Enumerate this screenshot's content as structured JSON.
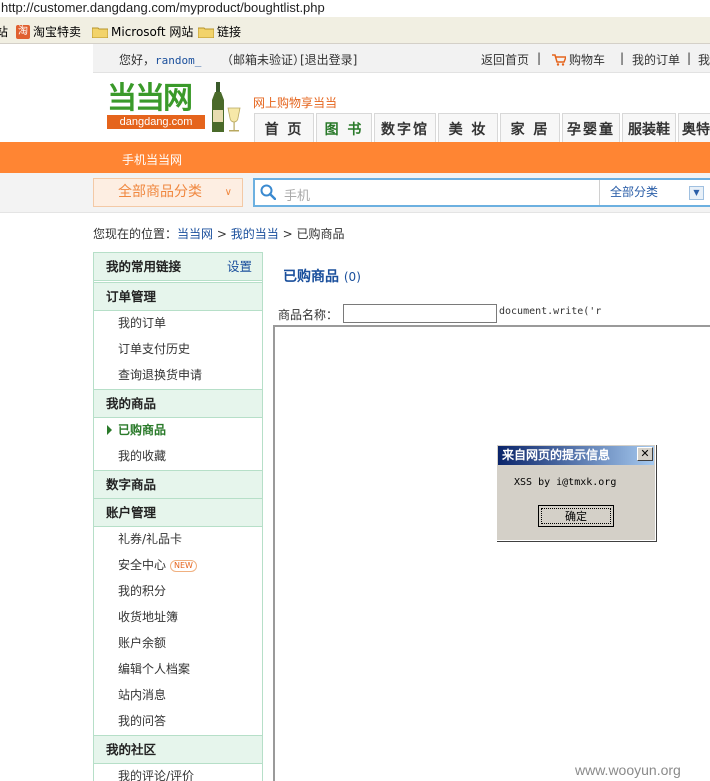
{
  "browser": {
    "url": "http://customer.dangdang.com/myproduct/boughtlist.php",
    "links": [
      {
        "label": "站",
        "icon": "none"
      },
      {
        "label": "淘宝特卖",
        "icon": "taobao-icon"
      },
      {
        "label": "Microsoft 网站",
        "icon": "folder-icon"
      },
      {
        "label": "链接",
        "icon": "folder-icon"
      }
    ],
    "taobao_glyph": "淘"
  },
  "topbar": {
    "greeting": "您好，",
    "username": "random_",
    "email_status": "（邮箱未验证）",
    "logout": "[退出登录]",
    "home": "返回首页",
    "cart": "购物车",
    "orders": "我的订单",
    "more": "我"
  },
  "logo": {
    "cn": "当当网",
    "en": "dangdang.com"
  },
  "slogan": "网上购物享当当",
  "nav": [
    "首 页",
    "图 书",
    "数字馆",
    "美 妆",
    "家 居",
    "孕婴童",
    "服装鞋",
    "奥特"
  ],
  "mobile_link": "手机当当网",
  "search": {
    "all_categories": "全部商品分类",
    "placeholder": "手机",
    "category": "全部分类"
  },
  "breadcrumb": {
    "prefix": "您现在的位置：",
    "site": "当当网",
    "section": "我的当当",
    "current": "已购商品",
    "sep": ">"
  },
  "sidebar": {
    "favorites_title": "我的常用链接",
    "settings": "设置",
    "groups": [
      {
        "title": "订单管理",
        "items": [
          "我的订单",
          "订单支付历史",
          "查询退换货申请"
        ]
      },
      {
        "title": "我的商品",
        "items": [
          "已购商品",
          "我的收藏"
        ]
      },
      {
        "title": "数字商品",
        "items": []
      },
      {
        "title": "账户管理",
        "items": [
          "礼券/礼品卡",
          "安全中心",
          "我的积分",
          "收货地址簿",
          "账户余额",
          "编辑个人档案",
          "站内消息",
          "我的问答"
        ]
      },
      {
        "title": "我的社区",
        "items": [
          "我的评论/评价"
        ]
      }
    ],
    "new_badge": "NEW"
  },
  "main": {
    "title": "已购商品",
    "count": "(0)",
    "name_label": "商品名称：",
    "name_value": "",
    "injected_text": "document.write('r"
  },
  "dialog": {
    "title": "来自网页的提示信息",
    "close": "✕",
    "message": "XSS by i@tmxk.org",
    "ok": "确定"
  },
  "watermark": "www.wooyun.org",
  "colors": {
    "accent_orange": "#ff8533",
    "brand_green": "#3a9a2a",
    "link_blue": "#1a4f9c"
  }
}
